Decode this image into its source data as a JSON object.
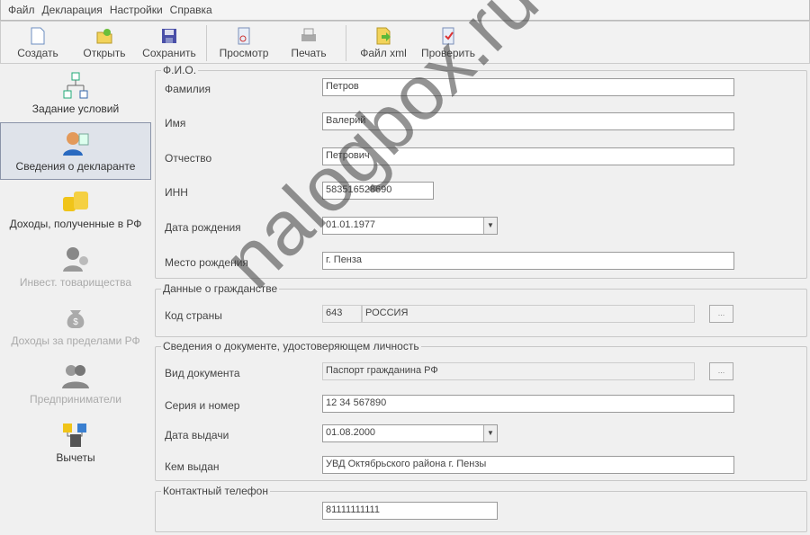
{
  "menu": [
    "Файл",
    "Декларация",
    "Настройки",
    "Справка"
  ],
  "toolbar": {
    "create": "Создать",
    "open": "Открыть",
    "save": "Сохранить",
    "preview": "Просмотр",
    "print": "Печать",
    "xml": "Файл xml",
    "check": "Проверить"
  },
  "sidebar": [
    "Задание условий",
    "Сведения о декларанте",
    "Доходы, полученные в РФ",
    "Инвест. товарищества",
    "Доходы за пределами РФ",
    "Предприниматели",
    "Вычеты"
  ],
  "fio": {
    "legend": "Ф.И.О.",
    "surname_label": "Фамилия",
    "surname": "Петров",
    "name_label": "Имя",
    "name": "Валерий",
    "patronymic_label": "Отчество",
    "patronymic": "Петрович",
    "inn_label": "ИНН",
    "inn": "583516528690",
    "birthdate_label": "Дата рождения",
    "birthdate": "01.01.1977",
    "birthplace_label": "Место рождения",
    "birthplace": "г. Пенза"
  },
  "citizenship": {
    "legend": "Данные о гражданстве",
    "country_label": "Код страны",
    "country_code": "643",
    "country_name": "РОССИЯ",
    "browse": "..."
  },
  "document": {
    "legend": "Сведения о документе, удостоверяющем личность",
    "type_label": "Вид документа",
    "type": "Паспорт гражданина РФ",
    "series_label": "Серия и номер",
    "series": "12 34 567890",
    "issue_date_label": "Дата выдачи",
    "issue_date": "01.08.2000",
    "issued_by_label": "Кем выдан",
    "issued_by": "УВД Октябрьского района г. Пензы",
    "browse": "..."
  },
  "phone": {
    "legend": "Контактный телефон",
    "value": "81111111111"
  },
  "watermark": "nalogbox.ru"
}
